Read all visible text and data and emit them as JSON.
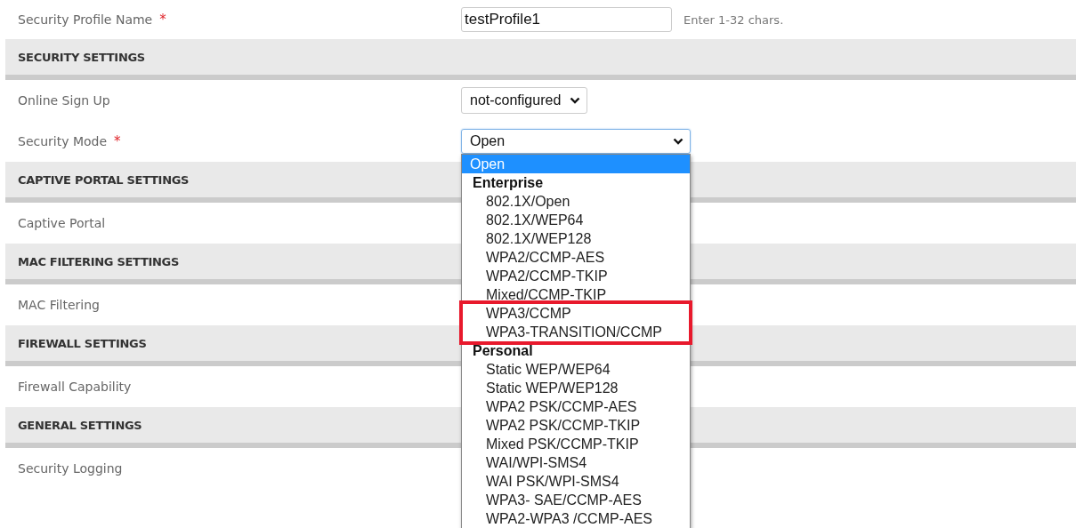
{
  "rows": [
    {
      "kind": "field",
      "label": "Security Profile Name",
      "required_mark": "*",
      "control": {
        "kind": "text",
        "value": "testProfile1"
      },
      "hint": "Enter 1-32 chars."
    },
    {
      "kind": "section",
      "label": "SECURITY SETTINGS"
    },
    {
      "kind": "field",
      "label": "Online Sign Up",
      "control": {
        "kind": "select",
        "value": "not-configured",
        "expanded": false
      }
    },
    {
      "kind": "field",
      "label": "Security Mode",
      "required_mark": "*",
      "control": {
        "kind": "select",
        "value": "Open",
        "expanded": true,
        "options": [
          {
            "kind": "option",
            "label": "Open",
            "selected": true,
            "highlighted": false
          },
          {
            "kind": "group",
            "label": "Enterprise",
            "children": [
              {
                "label": "802.1X/Open",
                "selected": false,
                "highlighted": false
              },
              {
                "label": "802.1X/WEP64",
                "selected": false,
                "highlighted": false
              },
              {
                "label": "802.1X/WEP128",
                "selected": false,
                "highlighted": false
              },
              {
                "label": "WPA2/CCMP-AES",
                "selected": false,
                "highlighted": false
              },
              {
                "label": "WPA2/CCMP-TKIP",
                "selected": false,
                "highlighted": false
              },
              {
                "label": "Mixed/CCMP-TKIP",
                "selected": false,
                "highlighted": false
              },
              {
                "label": "WPA3/CCMP",
                "selected": false,
                "highlighted": true
              },
              {
                "label": "WPA3-TRANSITION/CCMP",
                "selected": false,
                "highlighted": true
              }
            ]
          },
          {
            "kind": "group",
            "label": "Personal",
            "children": [
              {
                "label": "Static WEP/WEP64",
                "selected": false,
                "highlighted": false
              },
              {
                "label": "Static WEP/WEP128",
                "selected": false,
                "highlighted": false
              },
              {
                "label": "WPA2 PSK/CCMP-AES",
                "selected": false,
                "highlighted": false
              },
              {
                "label": "WPA2 PSK/CCMP-TKIP",
                "selected": false,
                "highlighted": false
              },
              {
                "label": "Mixed PSK/CCMP-TKIP",
                "selected": false,
                "highlighted": false
              },
              {
                "label": "WAI/WPI-SMS4",
                "selected": false,
                "highlighted": false
              },
              {
                "label": "WAI PSK/WPI-SMS4",
                "selected": false,
                "highlighted": false
              },
              {
                "label": "WPA3- SAE/CCMP-AES",
                "selected": false,
                "highlighted": false
              },
              {
                "label": "WPA2-WPA3 /CCMP-AES",
                "selected": false,
                "highlighted": false
              }
            ]
          }
        ]
      }
    },
    {
      "kind": "section",
      "label": "CAPTIVE PORTAL SETTINGS"
    },
    {
      "kind": "field",
      "label": "Captive Portal"
    },
    {
      "kind": "section",
      "label": "MAC FILTERING SETTINGS"
    },
    {
      "kind": "field",
      "label": "MAC Filtering"
    },
    {
      "kind": "section",
      "label": "FIREWALL SETTINGS"
    },
    {
      "kind": "field",
      "label": "Firewall Capability"
    },
    {
      "kind": "section",
      "label": "GENERAL SETTINGS"
    },
    {
      "kind": "field",
      "label": "Security Logging"
    }
  ]
}
